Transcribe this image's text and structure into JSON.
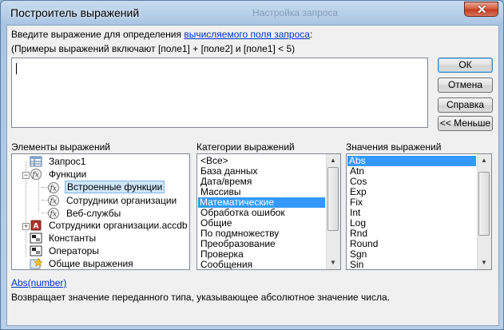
{
  "window": {
    "title": "Построитель выражений",
    "background_title": "Настройка запроса",
    "close_glyph": "✕"
  },
  "prompt": {
    "text": "Введите выражение для определения ",
    "link": "вычисляемого поля запроса",
    "suffix": ":"
  },
  "examples": "(Примеры выражений включают [поле1] + [поле2] и [поле1] < 5)",
  "expression_value": "",
  "buttons": {
    "ok": "ОК",
    "cancel": "Отмена",
    "help": "Справка",
    "less": "<< Меньше"
  },
  "elements": {
    "label": "Элементы выражений",
    "items": [
      {
        "label": "Запрос1",
        "icon": "query-icon",
        "expander": ""
      },
      {
        "label": "Функции",
        "icon": "function-icon",
        "expander": "−"
      },
      {
        "label": "Встроенные функции",
        "icon": "function-icon",
        "expander": ""
      },
      {
        "label": "Сотрудники организации",
        "icon": "function-icon",
        "expander": ""
      },
      {
        "label": "Веб-службы",
        "icon": "function-icon",
        "expander": ""
      },
      {
        "label": "Сотрудники организации.accdb",
        "icon": "database-icon",
        "expander": "+"
      },
      {
        "label": "Константы",
        "icon": "constants-icon",
        "expander": ""
      },
      {
        "label": "Операторы",
        "icon": "operators-icon",
        "expander": ""
      },
      {
        "label": "Общие выражения",
        "icon": "common-expressions-icon",
        "expander": ""
      }
    ]
  },
  "categories": {
    "label": "Категории выражений",
    "items": [
      "<Все>",
      "База данных",
      "Дата/время",
      "Массивы",
      "Математические",
      "Обработка ошибок",
      "Общие",
      "По подмножеству",
      "Преобразование",
      "Проверка",
      "Сообщения"
    ],
    "selected": "Математические"
  },
  "values": {
    "label": "Значения выражений",
    "items": [
      "Abs",
      "Atn",
      "Cos",
      "Exp",
      "Fix",
      "Int",
      "Log",
      "Rnd",
      "Round",
      "Sgn",
      "Sin"
    ],
    "selected": "Abs"
  },
  "syntax": "Abs(number)",
  "description": "Возвращает значение переданного типа, указывающее абсолютное значение числа.",
  "colors": {
    "selection": "#3399ff",
    "link": "#0033cc",
    "close": "#c43b1f"
  }
}
